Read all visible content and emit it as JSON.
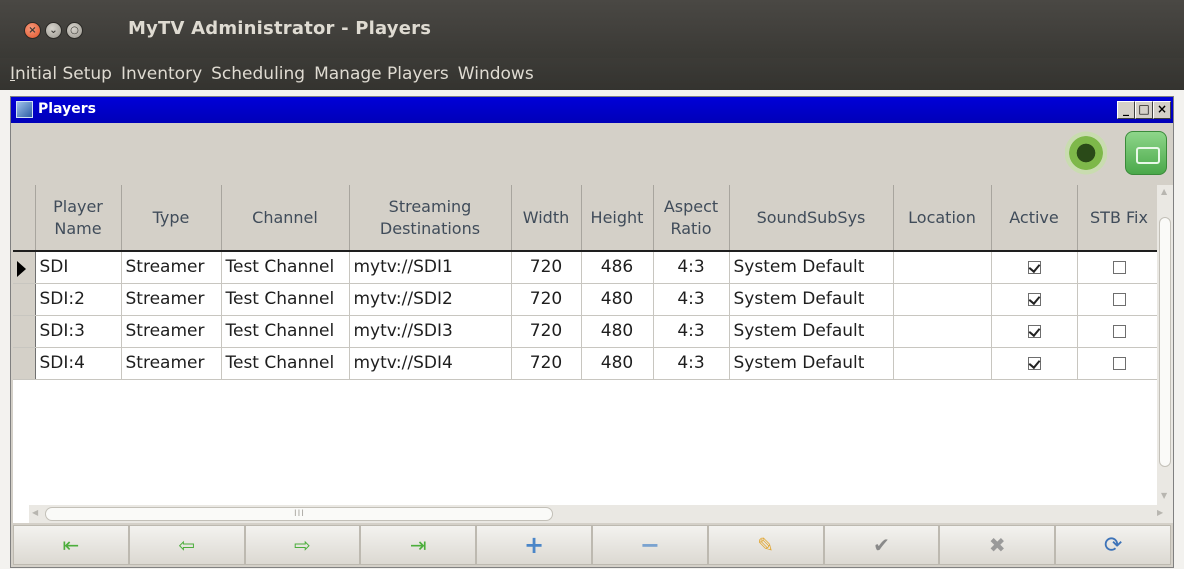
{
  "window": {
    "title": "MyTV Administrator - Players"
  },
  "menu": [
    {
      "mnemonic": "I",
      "rest": "nitial Setup"
    },
    {
      "mnemonic": "",
      "rest": "Inventory"
    },
    {
      "mnemonic": "",
      "rest": "Scheduling"
    },
    {
      "mnemonic": "",
      "rest": "Manage Players"
    },
    {
      "mnemonic": "",
      "rest": "Windows"
    }
  ],
  "inner_window": {
    "title": "Players",
    "controls": {
      "minimize": "_",
      "restore": "□",
      "close": "×"
    }
  },
  "toolbar": {
    "icons": [
      "swirl-icon",
      "video-camera-icon"
    ]
  },
  "table": {
    "columns": [
      {
        "key": "name",
        "label_lines": [
          "Player",
          "Name"
        ]
      },
      {
        "key": "type",
        "label_lines": [
          "Type"
        ]
      },
      {
        "key": "channel",
        "label_lines": [
          "Channel"
        ]
      },
      {
        "key": "streaming",
        "label_lines": [
          "Streaming",
          "Destinations"
        ]
      },
      {
        "key": "width",
        "label_lines": [
          "Width"
        ]
      },
      {
        "key": "height",
        "label_lines": [
          "Height"
        ]
      },
      {
        "key": "aspect",
        "label_lines": [
          "Aspect",
          "Ratio"
        ]
      },
      {
        "key": "sound",
        "label_lines": [
          "SoundSubSys"
        ]
      },
      {
        "key": "location",
        "label_lines": [
          "Location"
        ]
      },
      {
        "key": "active",
        "label_lines": [
          "Active"
        ]
      },
      {
        "key": "stbfix",
        "label_lines": [
          "STB Fix"
        ]
      }
    ],
    "rows": [
      {
        "name": "SDI",
        "type": "Streamer",
        "channel": "Test Channel",
        "streaming": "mytv://SDI1",
        "width": "720",
        "height": "486",
        "aspect": "4:3",
        "sound": "System Default",
        "location": "",
        "active": true,
        "stbfix": false,
        "current": true
      },
      {
        "name": "SDI:2",
        "type": "Streamer",
        "channel": "Test Channel",
        "streaming": "mytv://SDI2",
        "width": "720",
        "height": "480",
        "aspect": "4:3",
        "sound": "System Default",
        "location": "",
        "active": true,
        "stbfix": false,
        "current": false
      },
      {
        "name": "SDI:3",
        "type": "Streamer",
        "channel": "Test Channel",
        "streaming": "mytv://SDI3",
        "width": "720",
        "height": "480",
        "aspect": "4:3",
        "sound": "System Default",
        "location": "",
        "active": true,
        "stbfix": false,
        "current": false
      },
      {
        "name": "SDI:4",
        "type": "Streamer",
        "channel": "Test Channel",
        "streaming": "mytv://SDI4",
        "width": "720",
        "height": "480",
        "aspect": "4:3",
        "sound": "System Default",
        "location": "",
        "active": true,
        "stbfix": false,
        "current": false
      }
    ]
  },
  "hscroll": {
    "grip": "III"
  },
  "navigator": [
    {
      "name": "first-record-button",
      "icon": "first-icon",
      "glyph": "⇤"
    },
    {
      "name": "prior-record-button",
      "icon": "prior-icon",
      "glyph": "⇦"
    },
    {
      "name": "next-record-button",
      "icon": "next-icon",
      "glyph": "⇨"
    },
    {
      "name": "last-record-button",
      "icon": "last-icon",
      "glyph": "⇥"
    },
    {
      "name": "insert-record-button",
      "icon": "plus-icon",
      "glyph": "+"
    },
    {
      "name": "delete-record-button",
      "icon": "minus-icon",
      "glyph": "−"
    },
    {
      "name": "edit-record-button",
      "icon": "pencil-icon",
      "glyph": "✎"
    },
    {
      "name": "post-record-button",
      "icon": "check-icon",
      "glyph": "✔"
    },
    {
      "name": "cancel-edit-button",
      "icon": "x-icon",
      "glyph": "✖"
    },
    {
      "name": "refresh-button",
      "icon": "refresh-icon",
      "glyph": "⟳"
    }
  ]
}
